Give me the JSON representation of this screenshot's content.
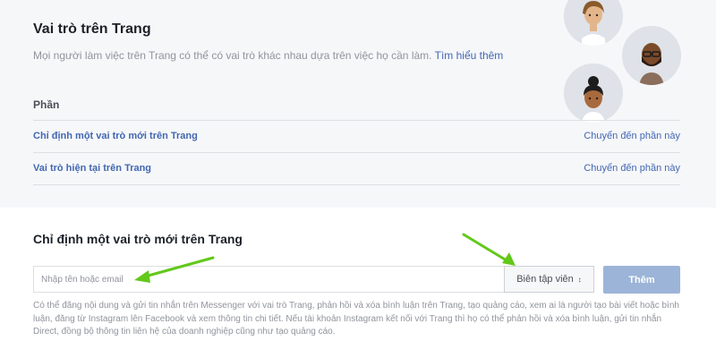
{
  "page_roles": {
    "title": "Vai trò trên Trang",
    "description": "Mọi người làm việc trên Trang có thể có vai trò khác nhau dựa trên việc họ cần làm.",
    "learn_more": "Tìm hiểu thêm"
  },
  "sections": {
    "label": "Phần",
    "items": [
      {
        "title": "Chỉ định một vai trò mới trên Trang",
        "link": "Chuyển đến phần này"
      },
      {
        "title": "Vai trò hiện tại trên Trang",
        "link": "Chuyển đến phần này"
      }
    ]
  },
  "assign_role": {
    "title": "Chỉ định một vai trò mới trên Trang",
    "input_placeholder": "Nhập tên hoặc email",
    "input_value": "",
    "role_selected": "Biên tập viên",
    "add_button": "Thêm",
    "help_text": "Có thể đăng nội dung và gửi tin nhắn trên Messenger với vai trò Trang, phản hồi và xóa bình luận trên Trang, tạo quảng cáo, xem ai là người tạo bài viết hoặc bình luận, đăng từ Instagram lên Facebook và xem thông tin chi tiết. Nếu tài khoản Instagram kết nối với Trang thì họ có thể phản hồi và xóa bình luận, gửi tin nhắn Direct, đồng bộ thông tin liên hệ của doanh nghiệp cũng như tạo quảng cáo."
  },
  "icons": {
    "avatars": [
      "avatar-woman-icon",
      "avatar-bearded-man-icon",
      "avatar-bun-woman-icon"
    ],
    "caret": "sort-caret-icon",
    "annotation_arrows": [
      "green-arrow-to-input",
      "green-arrow-to-role-select"
    ]
  },
  "colors": {
    "link": "#4267b2",
    "add_button_disabled": "#9cb4d8",
    "annotation_arrow": "#62c81a",
    "panel_background": "#f6f7f9"
  }
}
